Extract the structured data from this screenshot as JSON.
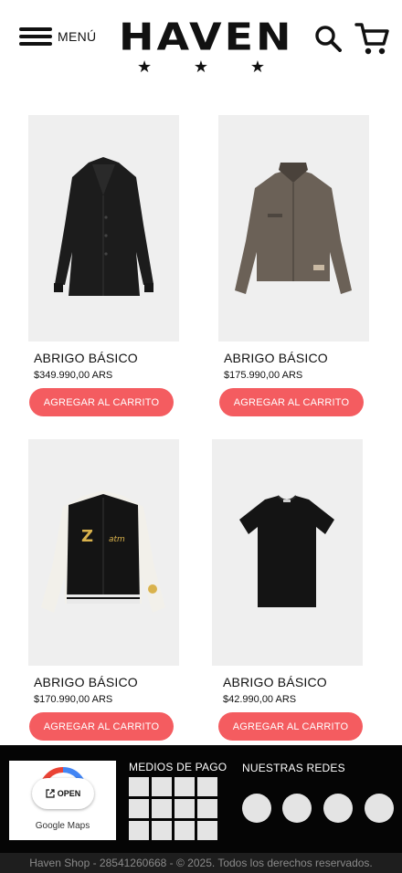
{
  "header": {
    "menu_label": "MENÚ",
    "logo_text": "HAVEN",
    "logo_stars": [
      "★",
      "★",
      "★"
    ]
  },
  "products": [
    {
      "name": "ABRIGO BÁSICO",
      "price": "$349.990,00 ARS",
      "button": "AGREGAR AL CARRITO",
      "image": "black-long-coat"
    },
    {
      "name": "ABRIGO BÁSICO",
      "price": "$175.990,00 ARS",
      "button": "AGREGAR AL CARRITO",
      "image": "brown-work-jacket"
    },
    {
      "name": "ABRIGO BÁSICO",
      "price": "$170.990,00 ARS",
      "button": "AGREGAR AL CARRITO",
      "image": "varsity-jacket"
    },
    {
      "name": "ABRIGO BÁSICO",
      "price": "$42.990,00 ARS",
      "button": "AGREGAR AL CARRITO",
      "image": "black-tshirt"
    }
  ],
  "footer": {
    "map_open_label": "OPEN",
    "map_brand": "Google Maps",
    "payment_title": "MEDIOS DE PAGO",
    "social_title": "NUESTRAS REDES",
    "copyright": "Haven Shop - 28541260668 - © 2025. Todos los derechos reservados."
  },
  "colors": {
    "accent": "#f45c60",
    "footer_bg": "#050505",
    "product_bg": "#efefef"
  }
}
